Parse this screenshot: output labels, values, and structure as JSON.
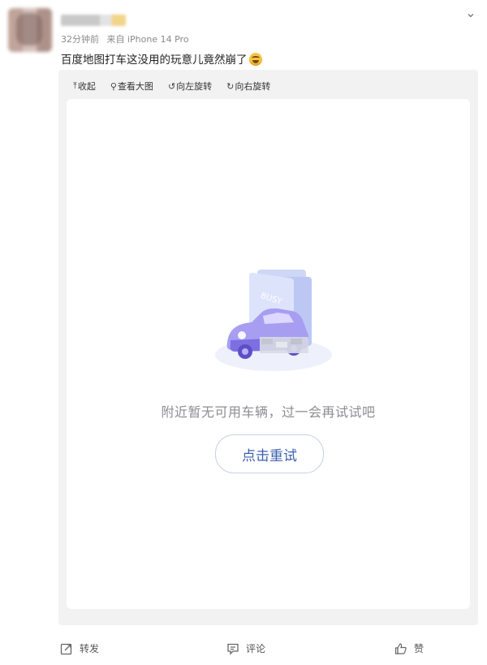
{
  "post": {
    "meta_time": "32分钟前",
    "meta_source": "来自 iPhone 14 Pro",
    "text": "百度地图打车这没用的玩意儿竟然崩了",
    "emoji_icon": "grinning-sweat-emoji"
  },
  "toolbar": {
    "collapse": "收起",
    "view_large": "查看大图",
    "rotate_left": "向左旋转",
    "rotate_right": "向右旋转"
  },
  "image": {
    "busy_sign": "BUSY",
    "empty_message": "附近暂无可用车辆，过一会再试试吧",
    "retry_label": "点击重试"
  },
  "actions": {
    "repost": "转发",
    "comment": "评论",
    "like": "赞"
  },
  "colors": {
    "accent_blue": "#3b62b0",
    "muted_text": "#8d8d92",
    "panel_bg": "#f2f2f2"
  }
}
